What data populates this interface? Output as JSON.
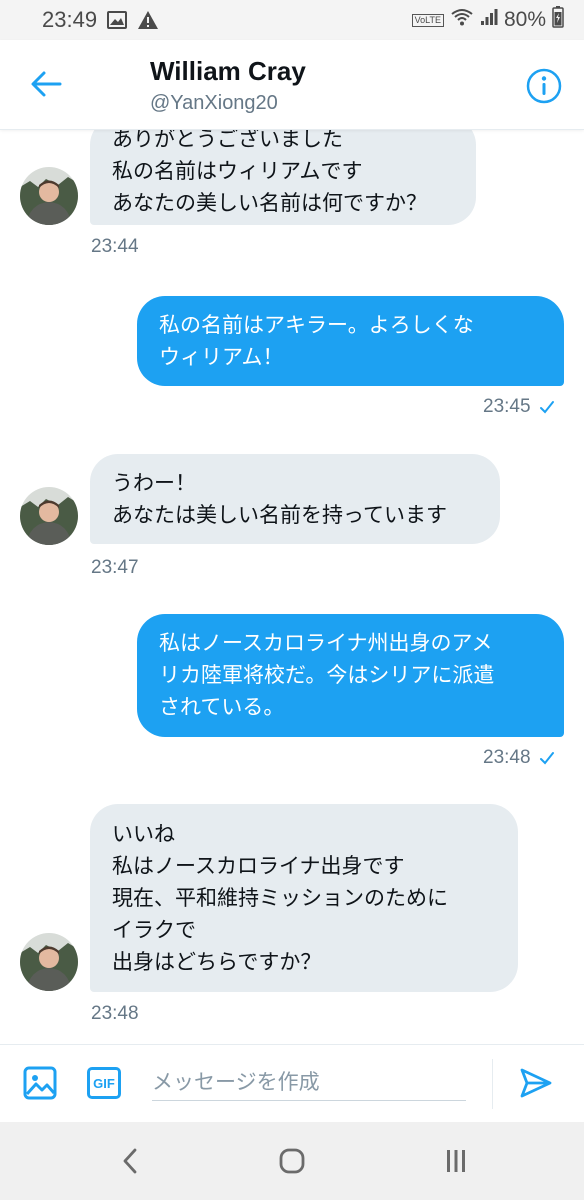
{
  "status_bar": {
    "time": "23:49",
    "volte": "VoLTE",
    "battery": "80%"
  },
  "header": {
    "name": "William Cray",
    "handle": "@YanXiong20"
  },
  "messages": [
    {
      "direction": "in",
      "lines": [
        "ありがとうございました",
        "私の名前はウィリアムです",
        "あなたの美しい名前は何ですか？"
      ],
      "time": "23:44"
    },
    {
      "direction": "out",
      "lines": [
        "私の名前はアキラー。よろしくな",
        "ウィリアム！"
      ],
      "time": "23:45"
    },
    {
      "direction": "in",
      "lines": [
        "うわー！",
        "あなたは美しい名前を持っています"
      ],
      "time": "23:47"
    },
    {
      "direction": "out",
      "lines": [
        "私はノースカロライナ州出身のアメ",
        "リカ陸軍将校だ。今はシリアに派遣",
        "されている。"
      ],
      "time": "23:48"
    },
    {
      "direction": "in",
      "lines": [
        "いいね",
        "私はノースカロライナ出身です",
        "現在、平和維持ミッションのために",
        "イラクで",
        "出身はどちらですか？"
      ],
      "time": "23:48"
    }
  ],
  "composer": {
    "gif_label": "GIF",
    "placeholder": "メッセージを作成"
  },
  "colors": {
    "accent": "#1da1f2",
    "incoming_bubble": "#e6ecf0",
    "muted_text": "#657786"
  },
  "icons": {
    "back": "arrow-left-icon",
    "info": "info-icon",
    "image": "image-icon",
    "gif": "gif-icon",
    "send": "send-icon",
    "check": "check-icon"
  }
}
